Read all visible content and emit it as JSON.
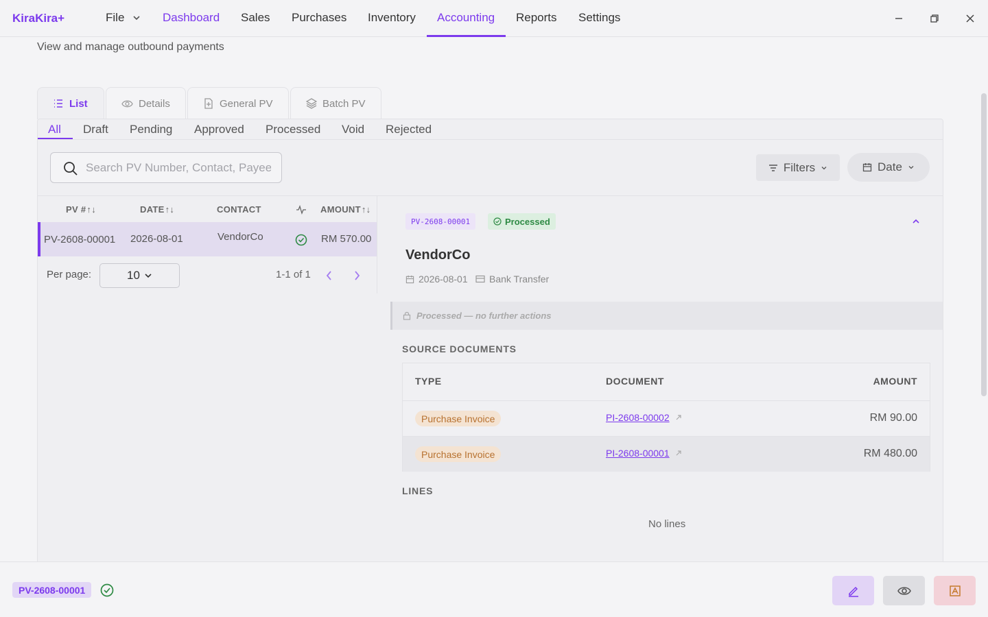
{
  "app": {
    "name": "KiraKira+"
  },
  "nav": {
    "file": "File",
    "items": [
      "Dashboard",
      "Sales",
      "Purchases",
      "Inventory",
      "Accounting",
      "Reports",
      "Settings"
    ],
    "active": "Accounting"
  },
  "page": {
    "subtitle": "View and manage outbound payments"
  },
  "view_tabs": [
    "List",
    "Details",
    "General PV",
    "Batch PV"
  ],
  "status_tabs": [
    "All",
    "Draft",
    "Pending",
    "Approved",
    "Processed",
    "Void",
    "Rejected"
  ],
  "search": {
    "placeholder": "Search PV Number, Contact, Payee..."
  },
  "toolbar": {
    "filters": "Filters",
    "date": "Date"
  },
  "table": {
    "headers": [
      "PV #",
      "DATE",
      "CONTACT",
      "AMOUNT"
    ],
    "rows": [
      {
        "pv": "PV-2608-00001",
        "date": "2026-08-01",
        "contact": "VendorCo",
        "status": "processed",
        "amount": "RM 570.00"
      }
    ]
  },
  "pagination": {
    "per_page_label": "Per page:",
    "per_page": "10",
    "info": "1-1 of 1"
  },
  "detail": {
    "pv_number": "PV-2608-00001",
    "status": "Processed",
    "vendor": "VendorCo",
    "date": "2026-08-01",
    "method": "Bank Transfer",
    "notice": "Processed — no further actions",
    "source_title": "SOURCE DOCUMENTS",
    "source_headers": [
      "TYPE",
      "DOCUMENT",
      "AMOUNT"
    ],
    "source_rows": [
      {
        "type": "Purchase Invoice",
        "document": "PI-2608-00002",
        "amount": "RM 90.00"
      },
      {
        "type": "Purchase Invoice",
        "document": "PI-2608-00001",
        "amount": "RM 480.00"
      }
    ],
    "lines_title": "LINES",
    "lines_empty": "No lines"
  },
  "footer": {
    "pv_number": "PV-2608-00001"
  },
  "colors": {
    "accent": "#7c3aed",
    "success": "#2e8a44",
    "warning": "#b7712f"
  }
}
